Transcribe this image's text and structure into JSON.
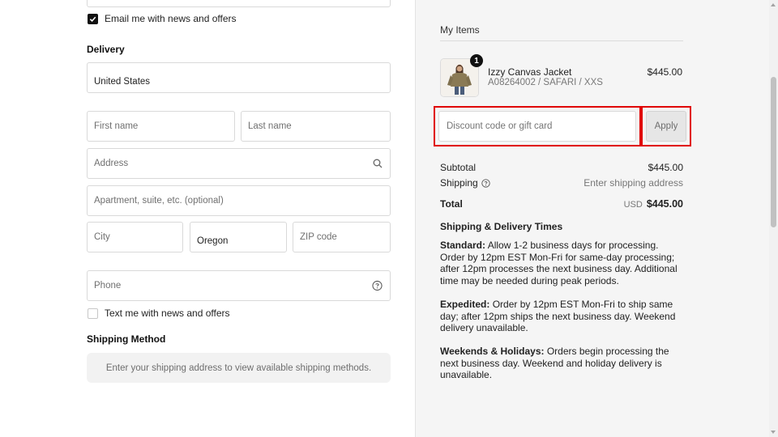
{
  "contact": {
    "email_optin_label": "Email me with news and offers",
    "email_optin_checked": true
  },
  "delivery": {
    "heading": "Delivery",
    "country_value": "United States",
    "first_name_placeholder": "First name",
    "last_name_placeholder": "Last name",
    "address_placeholder": "Address",
    "apartment_placeholder": "Apartment, suite, etc. (optional)",
    "city_placeholder": "City",
    "state_value": "Oregon",
    "zip_placeholder": "ZIP code",
    "phone_placeholder": "Phone",
    "sms_optin_label": "Text me with news and offers",
    "sms_optin_checked": false
  },
  "shipping_method": {
    "heading": "Shipping Method",
    "empty_message": "Enter your shipping address to view available shipping methods."
  },
  "summary": {
    "heading": "My Items",
    "item": {
      "name": "Izzy Canvas Jacket",
      "variant": "A08264002 / SAFARI / XXS",
      "price": "$445.00",
      "quantity": "1"
    },
    "discount_placeholder": "Discount code or gift card",
    "apply_label": "Apply",
    "subtotal_label": "Subtotal",
    "subtotal_value": "$445.00",
    "shipping_label": "Shipping",
    "shipping_value": "Enter shipping address",
    "total_label": "Total",
    "total_currency": "USD",
    "total_value": "$445.00"
  },
  "delivery_times": {
    "title": "Shipping & Delivery Times",
    "standard_label": "Standard:",
    "standard_text": "Allow 1-2 business days for processing. Order by 12pm EST Mon-Fri for same-day processing; after 12pm processes the next business day. Additional time may be needed during peak periods.",
    "expedited_label": "Expedited:",
    "expedited_text": "Order by 12pm EST Mon-Fri to ship same day; after 12pm ships the next business day. Weekend delivery unavailable.",
    "weekends_label": "Weekends & Holidays:",
    "weekends_text": "Orders begin processing the next business day. Weekend and holiday delivery is unavailable."
  },
  "colors": {
    "highlight": "#e00000",
    "summary_bg": "#f5f5f5",
    "checkbox_checked": "#111111"
  }
}
